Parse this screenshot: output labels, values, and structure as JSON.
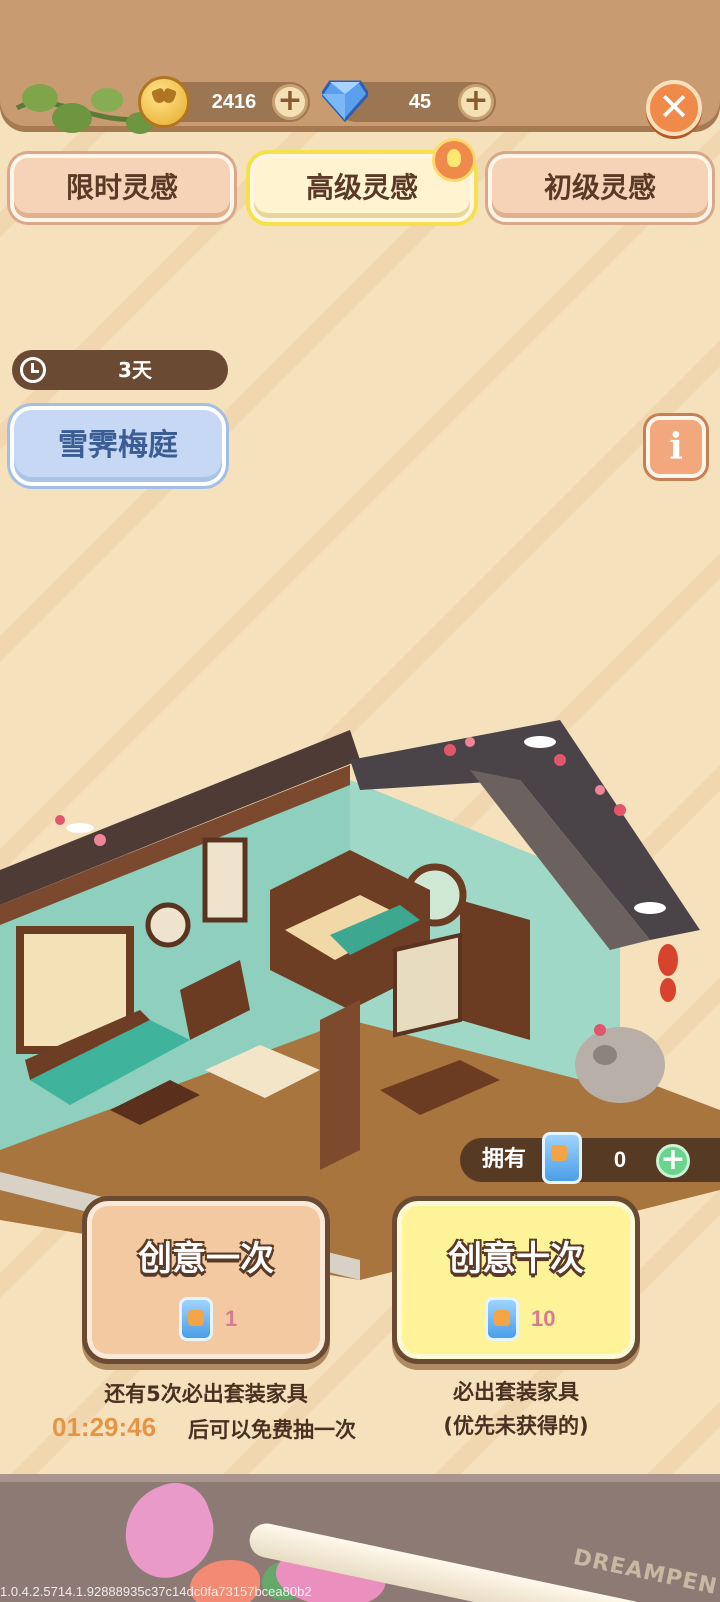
{
  "currencies": {
    "gold": {
      "value": "2416",
      "icon": "cat-coin-icon"
    },
    "gem": {
      "value": "45",
      "icon": "diamond-icon"
    }
  },
  "tabs": [
    {
      "label": "限时灵感",
      "selected": false
    },
    {
      "label": "高级灵感",
      "selected": true
    },
    {
      "label": "初级灵感",
      "selected": false
    }
  ],
  "banner": {
    "timer": "3天",
    "set_name": "雪霁梅庭"
  },
  "owned": {
    "label": "拥有",
    "count": "0"
  },
  "draw_one": {
    "title": "创意一次",
    "cost": "1"
  },
  "draw_ten": {
    "title": "创意十次",
    "cost": "10"
  },
  "notes": {
    "left_line1": "还有5次必出套装家具",
    "countdown": "01:29:46",
    "left_line2": "后可以免费抽一次",
    "right_line1": "必出套装家具",
    "right_line2": "(优先未获得的)"
  },
  "footer": {
    "pen_brand": "DREAMPEN",
    "build_id": "1.0.4.2.5714.1.92888935c37c14dc0fa73157bcea80b2"
  },
  "colors": {
    "background": "#f6e1bd",
    "accent_orange": "#f08a4b",
    "selected_tab_border": "#f5e24a",
    "set_title_blue": "#3b5d96",
    "plus_green": "#68d48c"
  }
}
